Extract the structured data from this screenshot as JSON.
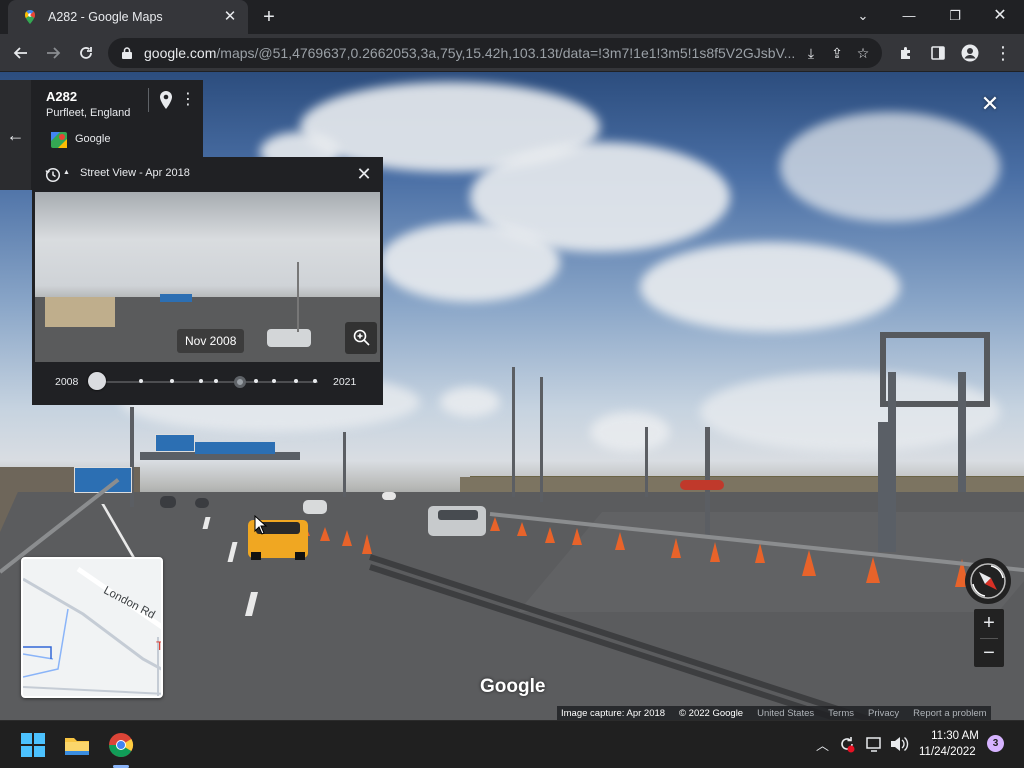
{
  "browser": {
    "tab_title": "A282 - Google Maps",
    "url_domain": "google.com",
    "url_path": "/maps/@51,4769637,0.2662053,3a,75y,15.42h,103.13t/data=!3m7!1e1!3m5!1s8f5V2GJsbV..."
  },
  "place": {
    "title": "A282",
    "subtitle": "Purfleet, England",
    "brand": "Google"
  },
  "time_machine": {
    "header": "Street View - Apr 2018",
    "tooltip": "Nov 2008",
    "start_year": "2008",
    "end_year": "2021",
    "selected_fraction": 0.0,
    "current_fraction": 0.65
  },
  "minimap": {
    "road_label": "London Rd",
    "edge_letter": "T"
  },
  "streetview": {
    "watermark": "Google",
    "attribution": {
      "capture": "Image capture: Apr 2018",
      "copyright": "© 2022 Google",
      "region": "United States",
      "terms": "Terms",
      "privacy": "Privacy",
      "report": "Report a problem"
    }
  },
  "taskbar": {
    "time": "11:30 AM",
    "date": "11/24/2022",
    "notification_count": "3"
  },
  "colors": {
    "chrome_dark": "#202124",
    "chrome_toolbar": "#35363a",
    "panel": "#202124",
    "cone_orange": "#e8632a",
    "car_yellow": "#f0a722"
  }
}
